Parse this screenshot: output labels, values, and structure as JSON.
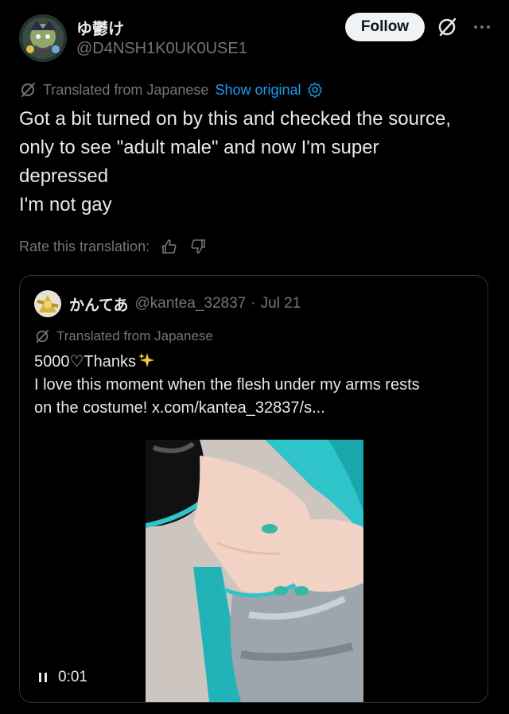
{
  "author": {
    "display_name": "ゆ鬱け",
    "handle": "@D4NSH1K0UK0USE1",
    "avatar_icon": "avatar-image"
  },
  "actions": {
    "follow_label": "Follow",
    "grok_icon": "grok-icon",
    "more_icon": "more-icon"
  },
  "translation": {
    "label": "Translated from Japanese",
    "show_original": "Show original",
    "settings_icon": "gear-icon"
  },
  "post": {
    "text": "Got a bit turned on by this and checked the source,\nonly to see \"adult male\" and now I'm super\ndepressed\nI'm not gay"
  },
  "rate": {
    "label": "Rate this translation:",
    "thumbs_up_icon": "thumbs-up-icon",
    "thumbs_down_icon": "thumbs-down-icon"
  },
  "quote": {
    "display_name": "かんてあ",
    "handle": "@kantea_32837",
    "separator": "·",
    "date": "Jul 21",
    "translation_label": "Translated from Japanese",
    "line1": "5000♡Thanks",
    "line2": "I love this moment when the flesh under my arms rests",
    "line3": "on the costume! x.com/kantea_32837/s...",
    "sparkle_icon": "sparkles-icon",
    "media": {
      "time": "0:01",
      "pause_icon": "pause-icon"
    }
  },
  "colors": {
    "background": "#000000",
    "text": "#e7e9ea",
    "muted": "#71767b",
    "link": "#1d9bf0",
    "border": "#2f3336",
    "follow_bg": "#eff3f4",
    "costume_teal": "#2ec4c9"
  }
}
